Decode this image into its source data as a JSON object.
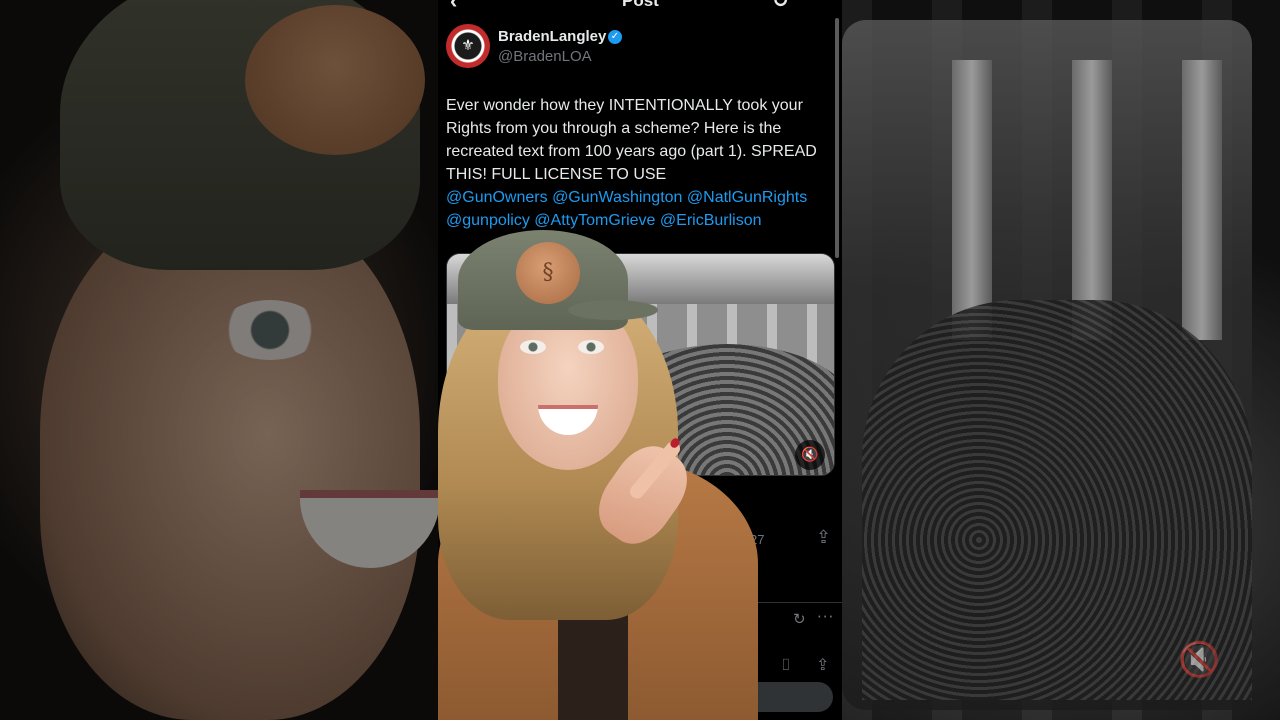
{
  "header": {
    "back_icon": "back-arrow-icon",
    "title": "Post",
    "refresh_icon": "refresh-icon"
  },
  "post": {
    "author_name": "BradenLangley",
    "verified_icon": "verified-badge-icon",
    "handle": "@BradenLOA",
    "text_intro": "Ever wonder how they INTENTIONALLY took your Rights from you through a scheme?  Here is the recreated text from 100 years ago (part 1). SPREAD THIS! FULL LICENSE TO USE",
    "mentions": [
      "@GunOwners",
      "@GunWashington",
      "@NatlGunRights",
      "@gunpolicy",
      "@AttyTomGrieve",
      "@EricBurlison"
    ],
    "media_mute_icon": "mute-icon"
  },
  "actions": {
    "bookmark_count": "27",
    "bookmark_icon": "bookmark-icon",
    "share_icon": "share-icon"
  },
  "colors": {
    "background": "#000000",
    "text": "#e7e9ea",
    "secondary_text": "#71767b",
    "link": "#1d9bf0"
  }
}
